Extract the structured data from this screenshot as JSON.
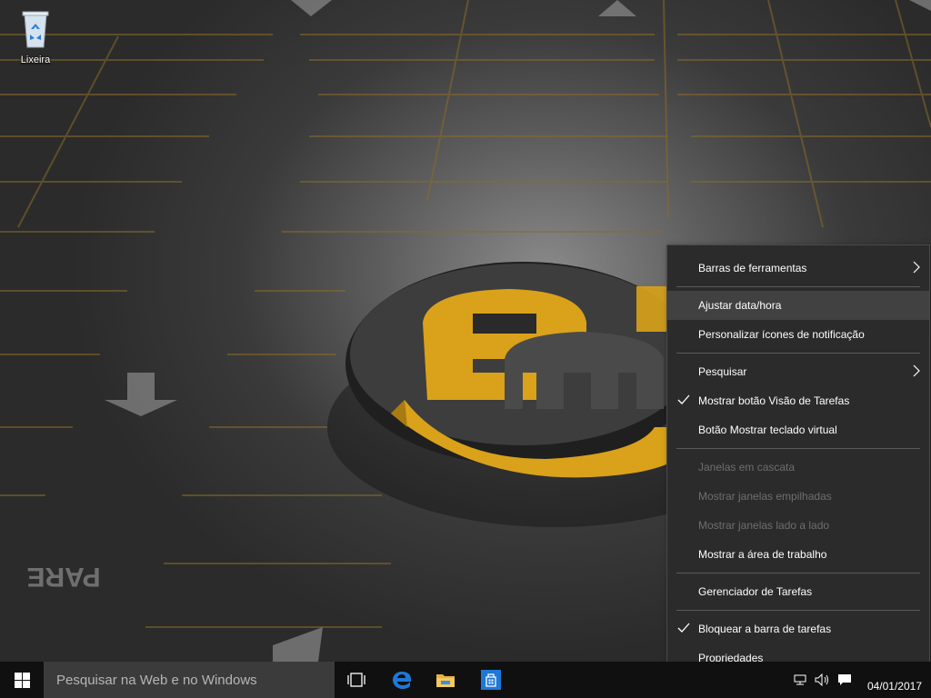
{
  "desktop": {
    "recycle_bin_label": "Lixeira",
    "wallpaper_text": "PARE"
  },
  "taskbar": {
    "search_placeholder": "Pesquisar na Web e no Windows",
    "icons": [
      "windows-logo-icon",
      "task-view-icon",
      "edge-icon",
      "file-explorer-icon",
      "store-icon",
      "network-icon",
      "volume-icon",
      "action-center-icon"
    ],
    "date": "04/01/2017"
  },
  "context_menu": {
    "items": [
      {
        "label": "Barras de ferramentas",
        "submenu": true
      },
      {
        "label": "Ajustar data/hora",
        "hovered": true
      },
      {
        "label": "Personalizar ícones de notificação"
      },
      {
        "label": "Pesquisar",
        "submenu": true
      },
      {
        "label": "Mostrar botão Visão de Tarefas",
        "checked": true
      },
      {
        "label": "Botão Mostrar teclado virtual"
      },
      {
        "label": "Janelas em cascata",
        "disabled": true
      },
      {
        "label": "Mostrar janelas empilhadas",
        "disabled": true
      },
      {
        "label": "Mostrar janelas lado a lado",
        "disabled": true
      },
      {
        "label": "Mostrar a área de trabalho"
      },
      {
        "label": "Gerenciador de Tarefas"
      },
      {
        "label": "Bloquear a barra de tarefas",
        "checked": true
      },
      {
        "label": "Propriedades"
      }
    ]
  },
  "colors": {
    "accent_yellow": "#d9a21a",
    "taskbar": "#101010",
    "menu_bg": "#2b2b2b",
    "edge_blue": "#1e78d7"
  }
}
